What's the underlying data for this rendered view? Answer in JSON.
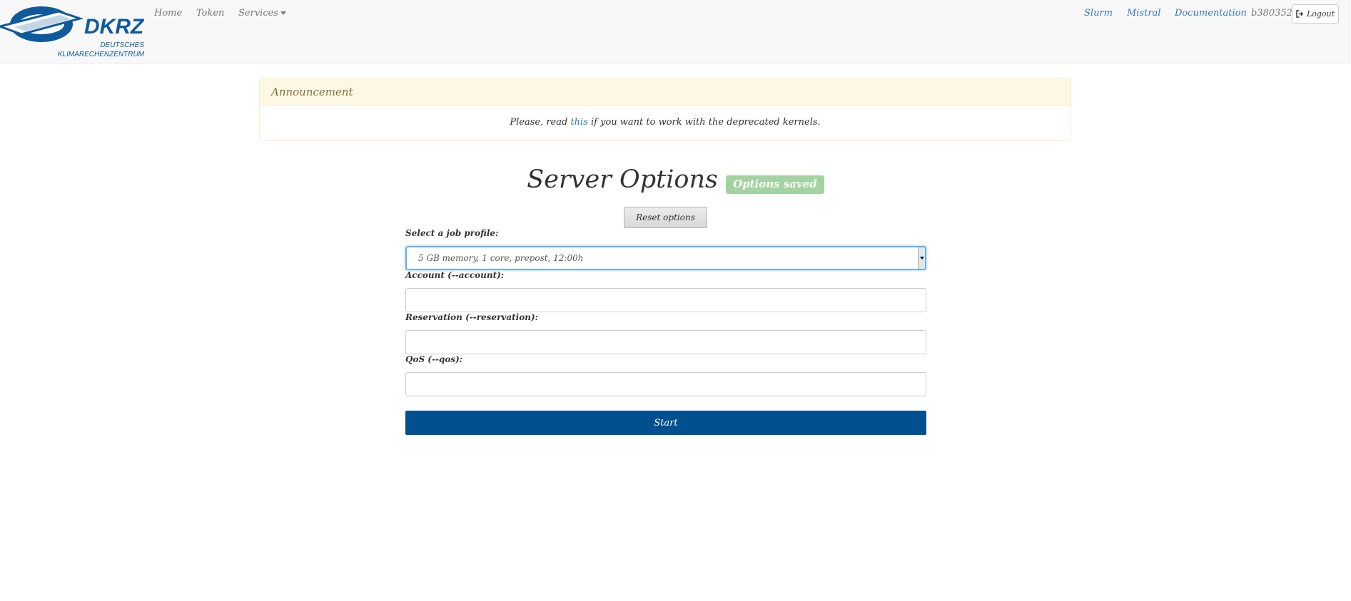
{
  "navbar": {
    "logo": {
      "name": "DKRZ",
      "subtitle_line1": "DEUTSCHES",
      "subtitle_line2": "KLIMARECHENZENTRUM",
      "color": "#0f5a9c"
    },
    "left_links": [
      "Home",
      "Token",
      "Services"
    ],
    "right_links": [
      "Slurm",
      "Mistral",
      "Documentation"
    ],
    "username": "b380352",
    "logout_label": "Logout"
  },
  "announcement": {
    "heading": "Announcement",
    "text_before": "Please, read ",
    "link_text": "this",
    "text_after": " if you want to work with the deprecated kernels."
  },
  "main": {
    "title": "Server Options",
    "badge": "Options saved",
    "reset_label": "Reset options",
    "form": {
      "profile_label": "Select a job profile:",
      "profile_value": "5 GB memory, 1 core, prepost, 12:00h",
      "account_label": "Account (--account):",
      "account_value": "",
      "reservation_label": "Reservation (--reservation):",
      "reservation_value": "",
      "qos_label": "QoS (--qos):",
      "qos_value": "",
      "start_label": "Start"
    }
  },
  "colors": {
    "brand": "#00508f",
    "link": "#337ab7",
    "badge": "#a3d3a0",
    "announcement_bg": "#fcf8e3"
  }
}
